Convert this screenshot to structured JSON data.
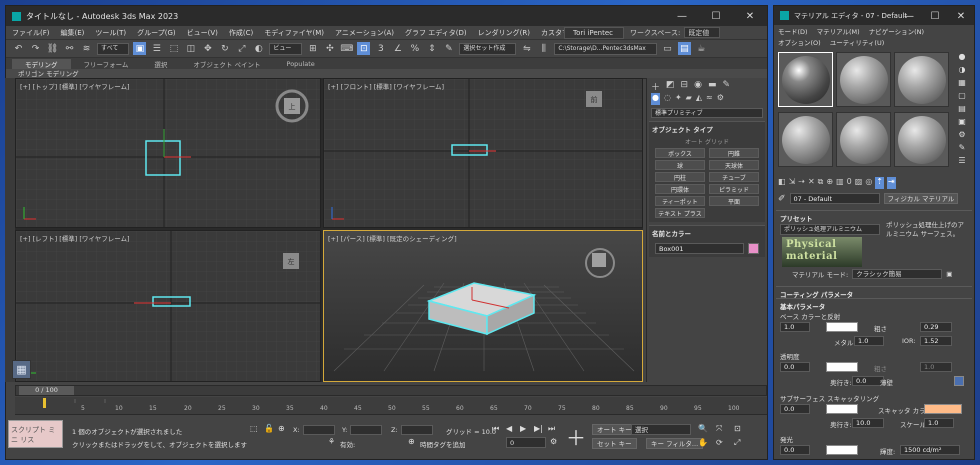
{
  "main": {
    "title": "タイトルなし - Autodesk 3ds Max 2023",
    "menus": [
      "ファイル(F)",
      "編集(E)",
      "ツール(T)",
      "グループ(G)",
      "ビュー(V)",
      "作成(C)",
      "モディファイヤ(M)",
      "アニメーション(A)",
      "グラフ エディタ(D)",
      "レンダリング(R)",
      "カスタマイズ(U)"
    ],
    "signin": "Tori iPentec",
    "workspace_label": "ワークスペース:",
    "workspace_value": "既定値",
    "toolbar": {
      "selection_filter": "すべて",
      "ref_coord": "ビュー",
      "named_sel": "選択セット作成",
      "project_path": "C:\\Storage\\D...Pentec3dsMax"
    },
    "ribbon_tabs": [
      "モデリング",
      "フリーフォーム",
      "選択",
      "オブジェクト ペイント",
      "Populate"
    ],
    "ribbon_sub": "ポリゴン モデリング",
    "viewports": {
      "top": "[+] [トップ] [標準] [ワイヤフレーム]",
      "front": "[+] [フロント] [標準] [ワイヤフレーム]",
      "left": "[+] [レフト] [標準] [ワイヤフレーム]",
      "persp": "[+] [パース] [標準] [既定のシェーディング]"
    },
    "view_cube": {
      "top": "上",
      "front": "前",
      "left": "左"
    },
    "command_panel": {
      "category": "標準プリミティブ",
      "object_type_header": "オブジェクト タイプ",
      "autogrid": "オート グリッド",
      "primitives": [
        "ボックス",
        "円錐",
        "球",
        "天球体",
        "円柱",
        "チューブ",
        "円環体",
        "ピラミッド",
        "ティーポット",
        "平面",
        "テキスト プラス"
      ],
      "name_color_header": "名前とカラー",
      "object_name": "Box001",
      "object_color": "#e890c8"
    },
    "timeline": {
      "position": "0 / 100",
      "ticks": [
        "5",
        "10",
        "15",
        "20",
        "25",
        "30",
        "35",
        "40",
        "45",
        "50",
        "55",
        "60",
        "65",
        "70",
        "75",
        "80",
        "85",
        "90",
        "95",
        "100"
      ]
    },
    "status": {
      "script": "スクリプト ミニ リス",
      "selected": "1 個のオブジェクトが選択されました",
      "prompt": "クリックまたはドラッグをして、オブジェクトを選択します",
      "x_label": "X:",
      "y_label": "Y:",
      "z_label": "Z:",
      "grid": "グリッド = 10.0",
      "enabled": "有効:",
      "add_time_tag": "時間タグを追加",
      "auto_key": "オート キー",
      "set_key": "セット キー",
      "key_mode": "選択",
      "frame": "0",
      "key_filter": "キー フィルタ..."
    }
  },
  "med": {
    "title": "マテリアル エディタ - 07 - Default",
    "menus": [
      "モード(D)",
      "マテリアル(M)",
      "ナビゲーション(N)",
      "オプション(O)",
      "ユーティリティ(U)"
    ],
    "material_name": "07 - Default",
    "material_type": "フィジカル マテリアル",
    "presets_header": "プリセット",
    "preset_value": "ポリッシュ処理アルミニウム",
    "logo_line1": "Physical",
    "logo_line2": "material",
    "preset_desc": "ポリッシュ処理仕上げのアルミニウム サーフェス。",
    "mode_label": "マテリアル モード:",
    "mode_value": "クラシック簡易",
    "coating_header": "コーティング パラメータ",
    "basic_header": "基本パラメータ",
    "base_color": "ベース カラーと反射",
    "base_weight": "1.0",
    "roughness_mode": "粗さ",
    "roughness": "0.29",
    "metalness_label": "メタル:",
    "metalness": "1.0",
    "ior_label": "IOR:",
    "ior": "1.52",
    "transparency": "透明度",
    "trans_weight": "0.0",
    "trans_rough_mode": "粗さ",
    "trans_rough": "1.0",
    "depth_label": "奥行き:",
    "depth": "0.0",
    "thin_wall": "薄壁",
    "sss": "サブサーフェス スキャッタリング",
    "sss_weight": "0.0",
    "scatter_label": "スキャッタ カラー:",
    "scatter_color": "#ffbb88",
    "sss_depth_label": "奥行き:",
    "sss_depth": "10.0",
    "scale_label": "スケール:",
    "scale": "1.0",
    "emission": "発光",
    "emission_weight": "0.0",
    "luminance_label": "輝度:",
    "luminance": "1500 cd/m²"
  }
}
